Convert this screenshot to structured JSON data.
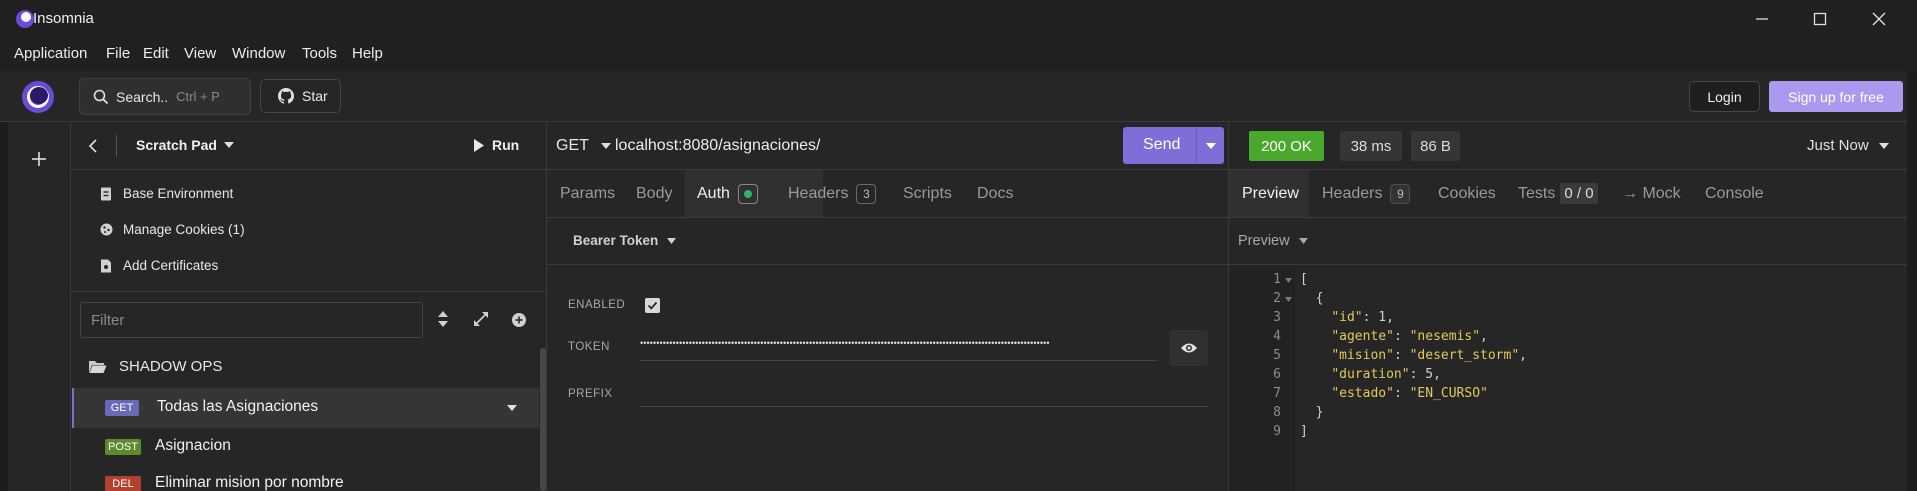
{
  "window": {
    "title": "Insomnia"
  },
  "menu": [
    "Application",
    "File",
    "Edit",
    "View",
    "Window",
    "Tools",
    "Help"
  ],
  "toolbar": {
    "search_label": "Search..",
    "search_shortcut": "Ctrl + P",
    "star_label": "Star",
    "login_label": "Login",
    "signup_label": "Sign up for free"
  },
  "sidebar": {
    "project": "Scratch Pad",
    "run_label": "Run",
    "items": [
      "Base Environment",
      "Manage Cookies (1)",
      "Add Certificates"
    ],
    "filter_placeholder": "Filter",
    "folder": "SHADOW OPS",
    "requests": [
      {
        "method": "GET",
        "name": "Todas las Asignaciones",
        "color": "#6b68b8"
      },
      {
        "method": "POST",
        "name": "Asignacion",
        "color": "#5d8a2a"
      },
      {
        "method": "DEL",
        "name": "Eliminar mision por nombre",
        "color": "#b3412f"
      }
    ]
  },
  "request": {
    "method": "GET",
    "url": "localhost:8080/asignaciones/",
    "send_label": "Send",
    "tabs": {
      "params": "Params",
      "body": "Body",
      "auth": "Auth",
      "headers": "Headers",
      "headers_count": "3",
      "scripts": "Scripts",
      "docs": "Docs"
    },
    "auth_type": "Bearer Token",
    "fields": {
      "enabled": "ENABLED",
      "token": "TOKEN",
      "prefix": "PREFIX"
    },
    "token_mask": "••••••••••••••••••••••••••••••••••••••••••••••••••••••••••••••••••••••••••••••••••••••••••••••••••••••••••••••••••••••••••••••"
  },
  "response": {
    "status": "200 OK",
    "time": "38 ms",
    "size": "86 B",
    "when": "Just Now",
    "tabs": {
      "preview": "Preview",
      "headers": "Headers",
      "headers_count": "9",
      "cookies": "Cookies",
      "tests": "Tests",
      "tests_count": "0 / 0",
      "mock": "→ Mock",
      "console": "Console"
    },
    "preview_mode": "Preview",
    "line_numbers": [
      "1",
      "2",
      "3",
      "4",
      "5",
      "6",
      "7",
      "8",
      "9"
    ]
  },
  "colors": {
    "accent": "#7e6fd8",
    "status_ok": "#4aa82d",
    "active_dot": "#2fb36a"
  }
}
